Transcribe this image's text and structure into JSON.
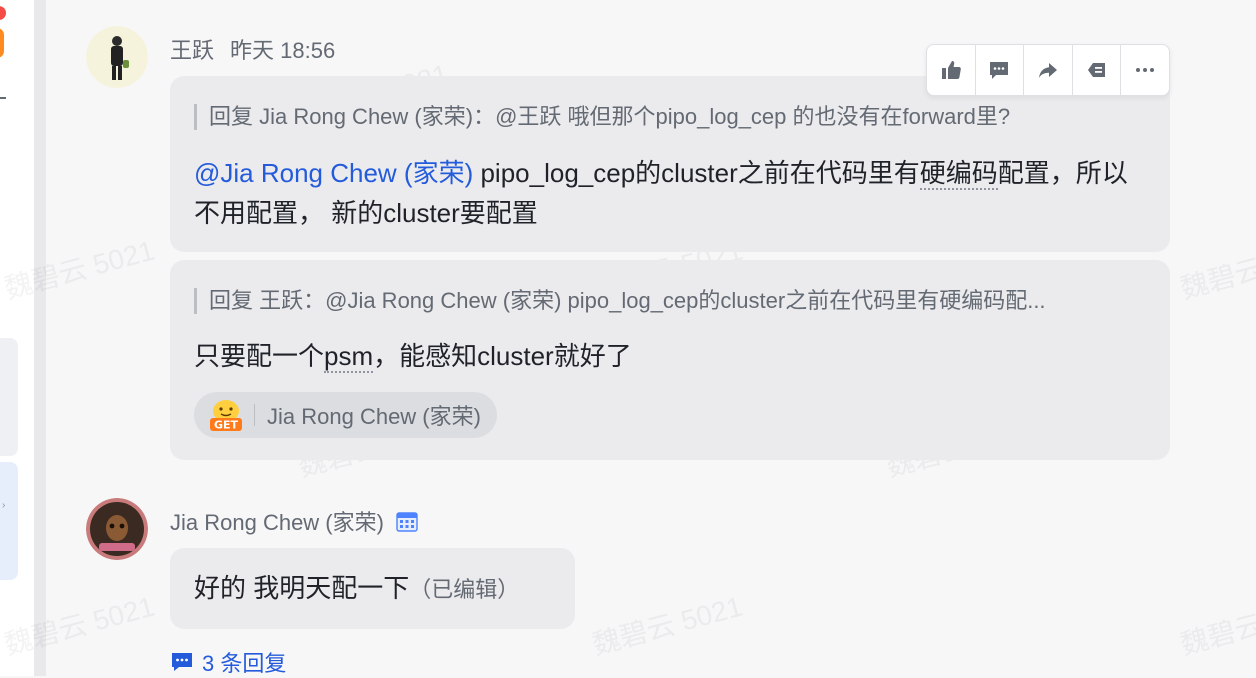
{
  "watermark": "魏碧云 5021",
  "toolbar": {
    "icons": [
      "thumbs-up-icon",
      "comment-icon",
      "forward-icon",
      "quote-reply-icon",
      "more-icon"
    ]
  },
  "messages": [
    {
      "sender": "王跃",
      "time": "昨天 18:56",
      "bubbles": [
        {
          "quote": "回复 Jia Rong Chew (家荣)：@王跃 哦但那个pipo_log_cep 的也没有在forward里?",
          "mention": "@Jia Rong Chew (家荣)",
          "text_a": " pipo_log_cep的cluster之前在代码里有",
          "text_dotted": "硬编码",
          "text_b": "配置，所以不用配置， 新的cluster要配置"
        },
        {
          "quote": "回复 王跃：@Jia Rong Chew (家荣) pipo_log_cep的cluster之前在代码里有硬编码配...",
          "text_a": "只要配一个",
          "text_dotted": "psm",
          "text_b": "，能感知cluster就好了",
          "reaction": {
            "icon": "get-sticker-icon",
            "user": "Jia Rong Chew (家荣)"
          }
        }
      ]
    },
    {
      "sender": "Jia Rong Chew (家荣)",
      "sender_icon": "calendar-icon",
      "text": "好的 我明天配一下",
      "edited": "（已编辑）",
      "replies": "3 条回复"
    }
  ],
  "colors": {
    "mention": "#245bdb",
    "bubble": "#ebebee",
    "background": "#f7f7f8"
  }
}
